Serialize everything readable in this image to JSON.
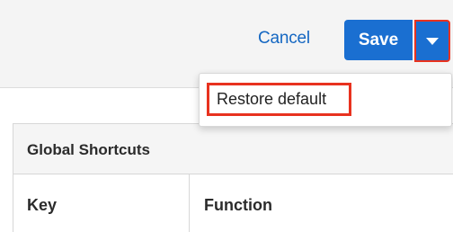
{
  "header": {
    "cancel_label": "Cancel",
    "save_label": "Save",
    "actions_toggle_icon": "caret-down-icon"
  },
  "dropdown": {
    "items": [
      {
        "label": "Restore default"
      }
    ]
  },
  "table": {
    "title": "Global Shortcuts",
    "columns": [
      "Key",
      "Function"
    ]
  },
  "colors": {
    "primary": "#1a6fd1",
    "link": "#1567c2",
    "highlight": "#e8321f"
  }
}
